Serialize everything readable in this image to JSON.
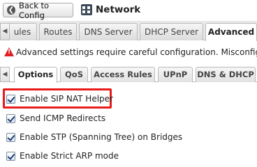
{
  "header": {
    "back_label": "Back to Config",
    "back_icon": "back-arrow-icon",
    "title": "Network",
    "title_icon": "network-icon"
  },
  "main_tabs": [
    {
      "label": "Rules",
      "display": "ules",
      "active": false
    },
    {
      "label": "Routes",
      "active": false
    },
    {
      "label": "DNS Server",
      "active": false
    },
    {
      "label": "DHCP Server",
      "active": false
    },
    {
      "label": "Advanced",
      "active": true
    }
  ],
  "warning": {
    "text": "Advanced settings require careful configuration. Misconfiguration",
    "color": "#e02020"
  },
  "sub_tabs": [
    {
      "label": "Options",
      "active": true
    },
    {
      "label": "QoS",
      "active": false
    },
    {
      "label": "Access Rules",
      "active": false
    },
    {
      "label": "UPnP",
      "active": false
    },
    {
      "label": "DNS & DHCP",
      "active": false
    }
  ],
  "options": [
    {
      "label": "Enable SIP NAT Helper",
      "checked": true,
      "highlighted": true
    },
    {
      "label": "Send ICMP Redirects",
      "checked": true
    },
    {
      "label": "Enable STP (Spanning Tree) on Bridges",
      "checked": true
    },
    {
      "label": "Enable Strict ARP mode",
      "checked": true
    }
  ],
  "colors": {
    "highlight": "#e81b1b",
    "tab_border": "#b9b9b9"
  }
}
